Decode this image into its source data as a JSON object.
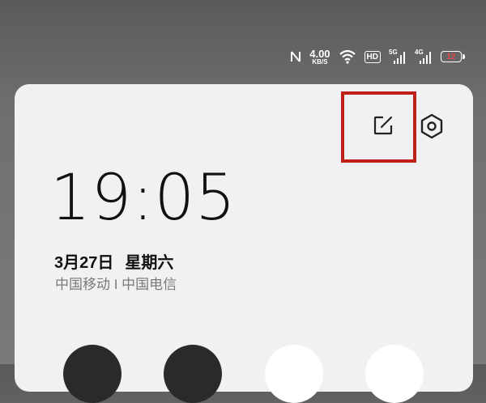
{
  "statusbar": {
    "nfc_icon": "nfc-icon",
    "speed_value": "4.00",
    "speed_unit": "KB/S",
    "wifi_icon": "wifi-icon",
    "hd_label": "HD",
    "net1_label": "5G",
    "net2_label": "4G",
    "battery_level": "12",
    "battery_level_color": "#e0474c"
  },
  "panel": {
    "edit_icon": "edit-icon",
    "settings_icon": "settings-icon",
    "clock": "19:05",
    "date": "3月27日",
    "weekday": "星期六",
    "carrier": "中国移动 I 中国电信",
    "highlight_color": "#c0201a"
  },
  "quick_tiles": [
    {
      "style": "dark"
    },
    {
      "style": "dark"
    },
    {
      "style": "light"
    },
    {
      "style": "light"
    }
  ]
}
